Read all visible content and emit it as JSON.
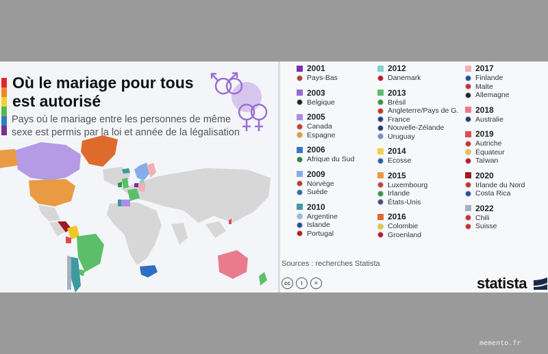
{
  "title": "Où le mariage pour tous est autorisé",
  "subtitle": "Pays où le mariage entre les personnes de même sexe est permis par la loi et année de la légalisation",
  "colors": {
    "rainbow": [
      "#e4262b",
      "#ef8a23",
      "#f6d32c",
      "#58b947",
      "#2f7dc1",
      "#7a2f8f"
    ],
    "map_base": "#d6d6d6",
    "ocean": "#f3f5f8"
  },
  "legend": {
    "col1": [
      {
        "year": "2001",
        "color": "#7b2fb1",
        "countries": [
          {
            "name": "Pays-Bas",
            "flag": "#c0392b"
          }
        ]
      },
      {
        "year": "2003",
        "color": "#9a6ad8",
        "countries": [
          {
            "name": "Belgique",
            "flag": "#222222"
          }
        ]
      },
      {
        "year": "2005",
        "color": "#ad8be6",
        "countries": [
          {
            "name": "Canada",
            "flag": "#e0312f"
          },
          {
            "name": "Espagne",
            "flag": "#e7a21b"
          }
        ]
      },
      {
        "year": "2006",
        "color": "#3c76c3",
        "countries": [
          {
            "name": "Afrique du Sud",
            "flag": "#1e8a3a"
          }
        ]
      },
      {
        "year": "2009",
        "color": "#86aee8",
        "countries": [
          {
            "name": "Norvège",
            "flag": "#c0392b"
          },
          {
            "name": "Suède",
            "flag": "#2d6db5"
          }
        ]
      },
      {
        "year": "2010",
        "color": "#3d9aa0",
        "countries": [
          {
            "name": "Argentine",
            "flag": "#8cc0e6"
          },
          {
            "name": "Islande",
            "flag": "#1f4fa0"
          },
          {
            "name": "Portugal",
            "flag": "#b02020"
          }
        ]
      }
    ],
    "col2": [
      {
        "year": "2012",
        "color": "#83d1cf",
        "countries": [
          {
            "name": "Danemark",
            "flag": "#c8102e"
          }
        ]
      },
      {
        "year": "2013",
        "color": "#5bbf6a",
        "countries": [
          {
            "name": "Brésil",
            "flag": "#2a9a3f"
          },
          {
            "name": "Angleterre/Pays de G.",
            "flag": "#d22d2d"
          },
          {
            "name": "France",
            "flag": "#1f3f9b"
          },
          {
            "name": "Nouvelle-Zélande",
            "flag": "#203a7a"
          },
          {
            "name": "Uruguay",
            "flag": "#6f8fcf"
          }
        ]
      },
      {
        "year": "2014",
        "color": "#f2d048",
        "countries": [
          {
            "name": "Ecosse",
            "flag": "#1f5fb0"
          }
        ]
      },
      {
        "year": "2015",
        "color": "#e99a42",
        "countries": [
          {
            "name": "Luxembourg",
            "flag": "#d33b3b"
          },
          {
            "name": "Irlande",
            "flag": "#2d9a48"
          },
          {
            "name": "États-Unis",
            "flag": "#3a4f8f"
          }
        ]
      },
      {
        "year": "2016",
        "color": "#de6b2c",
        "countries": [
          {
            "name": "Colombie",
            "flag": "#f2c628"
          },
          {
            "name": "Groenland",
            "flag": "#c8102e"
          }
        ]
      }
    ],
    "col3": [
      {
        "year": "2017",
        "color": "#f1b0b6",
        "countries": [
          {
            "name": "Finlande",
            "flag": "#1f4fa0"
          },
          {
            "name": "Malte",
            "flag": "#d22d2d"
          },
          {
            "name": "Allemagne",
            "flag": "#222222"
          }
        ]
      },
      {
        "year": "2018",
        "color": "#e87c8c",
        "countries": [
          {
            "name": "Australie",
            "flag": "#203a7a"
          }
        ]
      },
      {
        "year": "2019",
        "color": "#e14a55",
        "countries": [
          {
            "name": "Autriche",
            "flag": "#d22d2d"
          },
          {
            "name": "Équateur",
            "flag": "#f2c628"
          },
          {
            "name": "Taïwan",
            "flag": "#c8102e"
          }
        ]
      },
      {
        "year": "2020",
        "color": "#9b1c1c",
        "countries": [
          {
            "name": "Irlande du Nord",
            "flag": "#d22d2d"
          },
          {
            "name": "Costa Rica",
            "flag": "#2d4f9f"
          }
        ]
      },
      {
        "year": "2022",
        "color": "#a6b1bf",
        "countries": [
          {
            "name": "Chili",
            "flag": "#d22d2d"
          },
          {
            "name": "Suisse",
            "flag": "#d22d2d"
          }
        ]
      }
    ]
  },
  "footer": {
    "sources": "Sources : recherches Statista",
    "brand": "statista",
    "license_icons": [
      "cc",
      "i",
      "="
    ]
  },
  "watermark": "memento.fr"
}
